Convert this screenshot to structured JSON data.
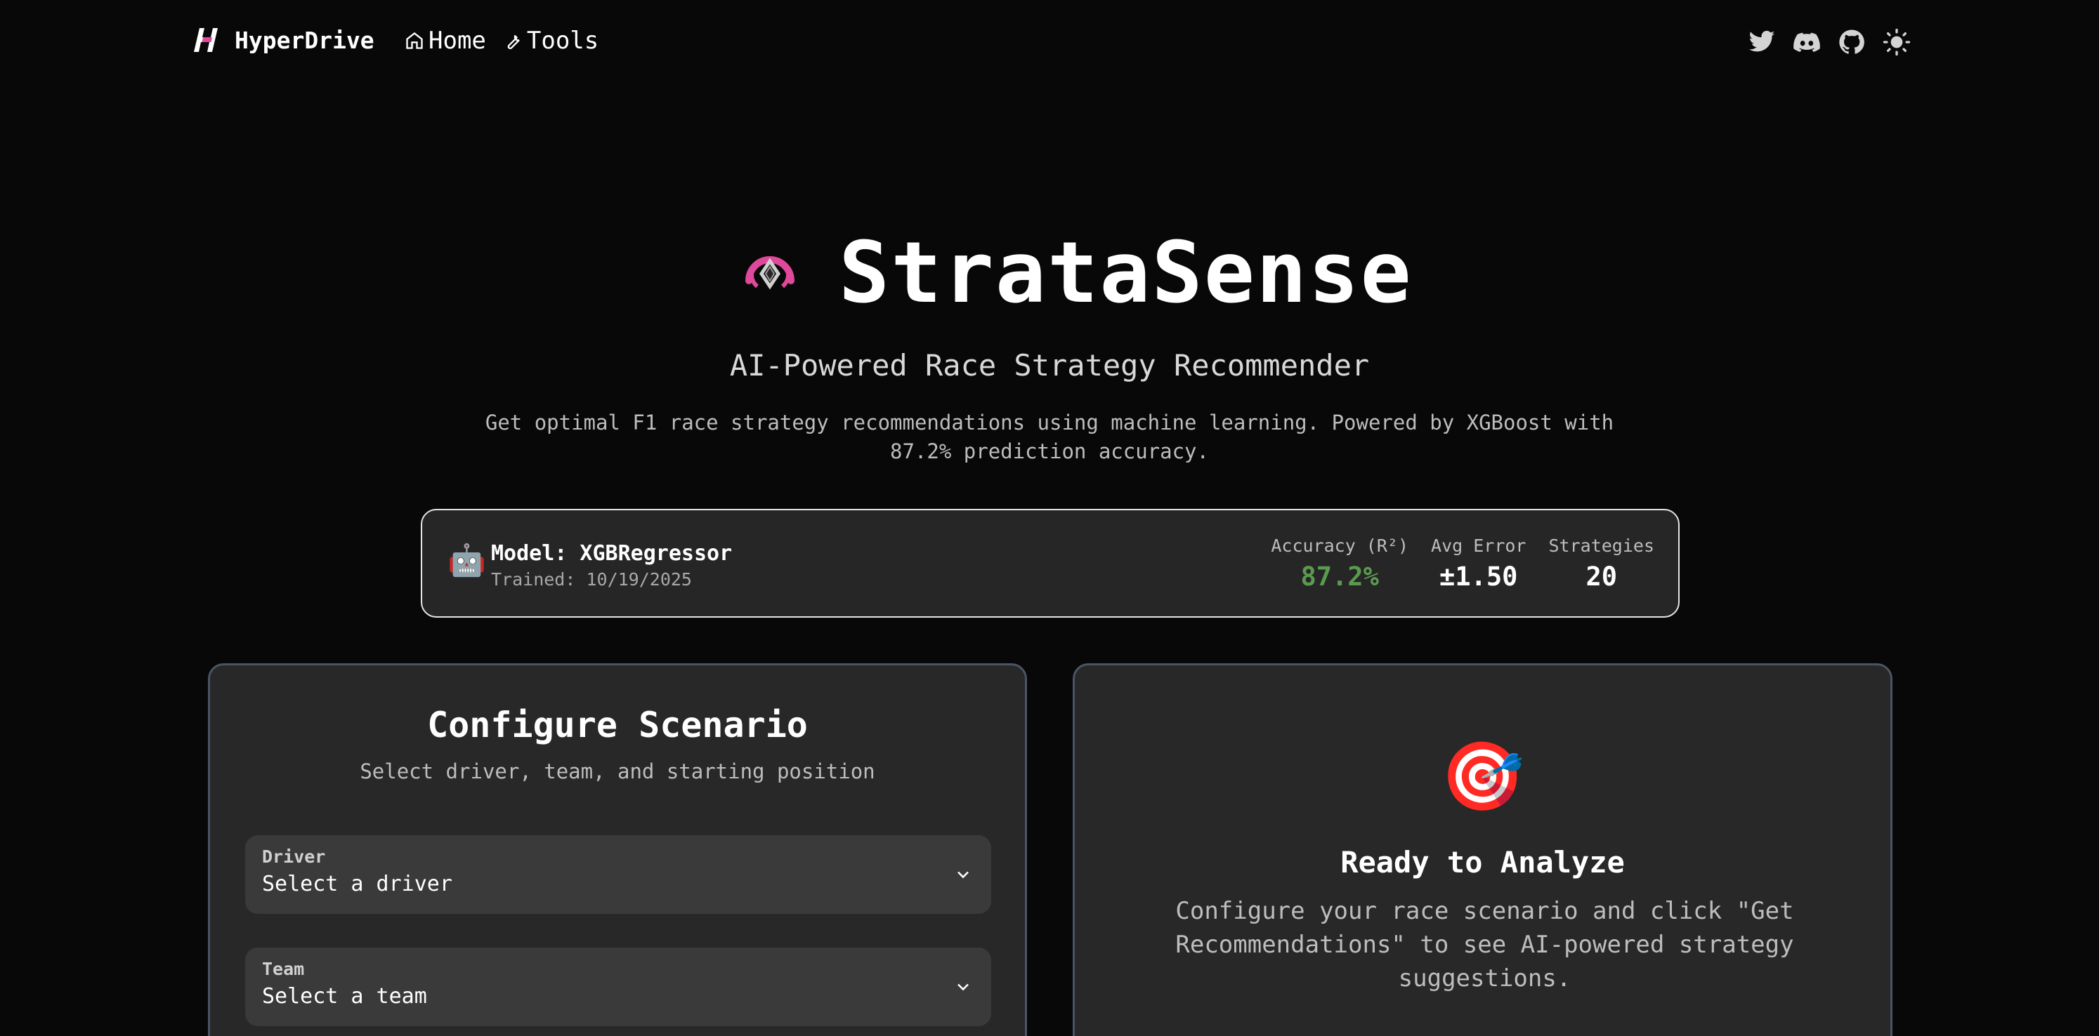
{
  "nav": {
    "brand": "HyperDrive",
    "links": [
      {
        "label": "Home",
        "icon": "home-icon"
      },
      {
        "label": "Tools",
        "icon": "wrench-icon"
      }
    ],
    "icons": [
      "twitter-icon",
      "discord-icon",
      "github-icon",
      "sun-icon"
    ]
  },
  "hero": {
    "title": "StrataSense",
    "subtitle": "AI-Powered Race Strategy Recommender",
    "description": "Get optimal F1 race strategy recommendations using machine learning. Powered by XGBoost with 87.2% prediction accuracy."
  },
  "model": {
    "icon": "🤖",
    "name": "Model: XGBRegressor",
    "trained": "Trained: 10/19/2025",
    "stats": [
      {
        "label": "Accuracy (R²)",
        "value": "87.2%"
      },
      {
        "label": "Avg Error",
        "value": "±1.50"
      },
      {
        "label": "Strategies",
        "value": "20"
      }
    ]
  },
  "configure": {
    "title": "Configure Scenario",
    "subtitle": "Select driver, team, and starting position",
    "fields": [
      {
        "label": "Driver",
        "value": "Select a driver"
      },
      {
        "label": "Team",
        "value": "Select a team"
      }
    ]
  },
  "ready": {
    "icon": "🎯",
    "title": "Ready to Analyze",
    "text": "Configure your race scenario and click \"Get Recommendations\" to see AI-powered strategy suggestions."
  },
  "colors": {
    "accent_pink": "#e0489a",
    "accuracy_green": "#5a9a4e",
    "panel_border": "#4a5566"
  }
}
